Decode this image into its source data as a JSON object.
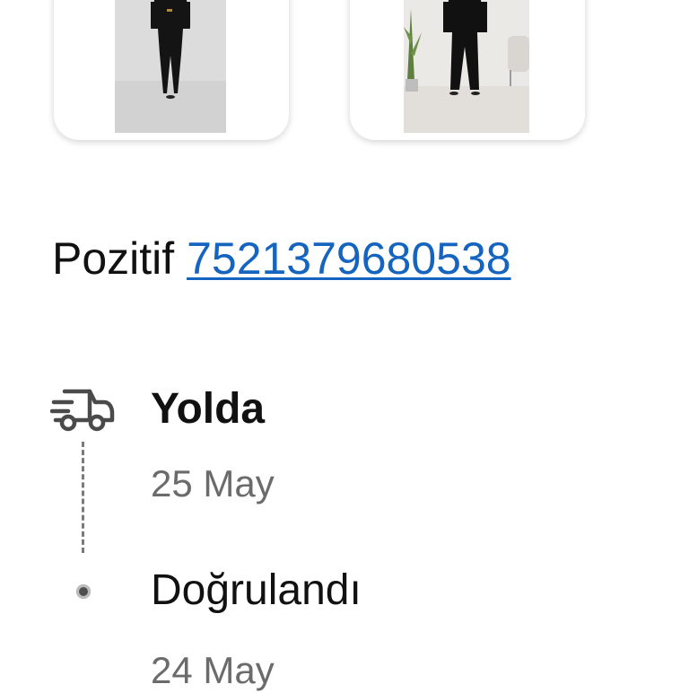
{
  "products": [
    {
      "image_alt": "Siyah takım elbise giymiş model"
    },
    {
      "image_alt": "Siyah tulum giymiş model"
    }
  ],
  "seller": {
    "name": "Pozitif",
    "tracking_number": "7521379680538"
  },
  "timeline": [
    {
      "status": "Yolda",
      "date": "25 May",
      "icon": "truck-icon"
    },
    {
      "status": "Doğrulandı",
      "date": "24 May",
      "icon": "dot-icon"
    }
  ],
  "colors": {
    "link": "#1565c0",
    "date": "#6b6b6b",
    "text": "#111111"
  }
}
